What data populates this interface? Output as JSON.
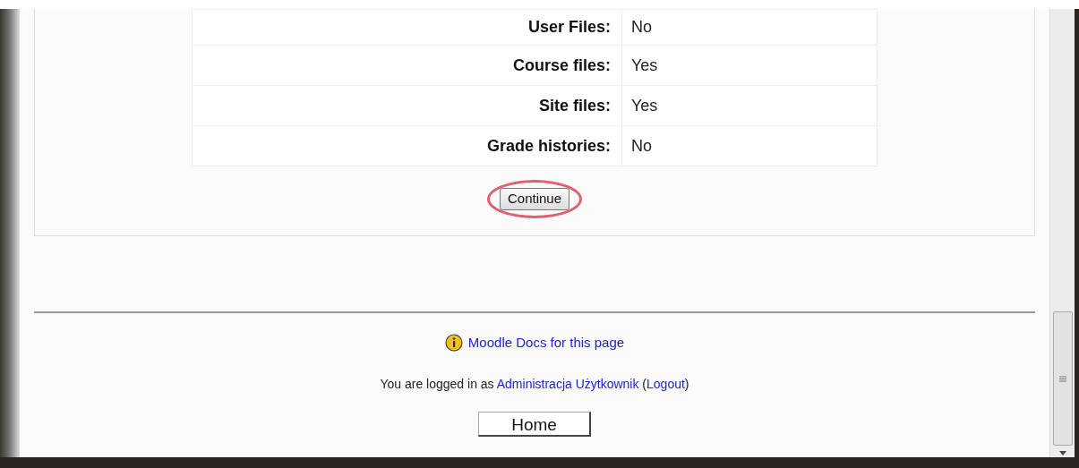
{
  "settings_table": {
    "rows": [
      {
        "label": "User Files:",
        "value": "No"
      },
      {
        "label": "Course files:",
        "value": "Yes"
      },
      {
        "label": "Site files:",
        "value": "Yes"
      },
      {
        "label": "Grade histories:",
        "value": "No"
      }
    ]
  },
  "continue_button": {
    "label": "Continue",
    "circled": true
  },
  "footer": {
    "docs_link": "Moodle Docs for this page",
    "login_text": "You are logged in as",
    "user_link": "Administracja Użytkownik",
    "paren_open": "(",
    "logout_link": "Logout",
    "paren_close": ")",
    "home_button": "Home"
  }
}
